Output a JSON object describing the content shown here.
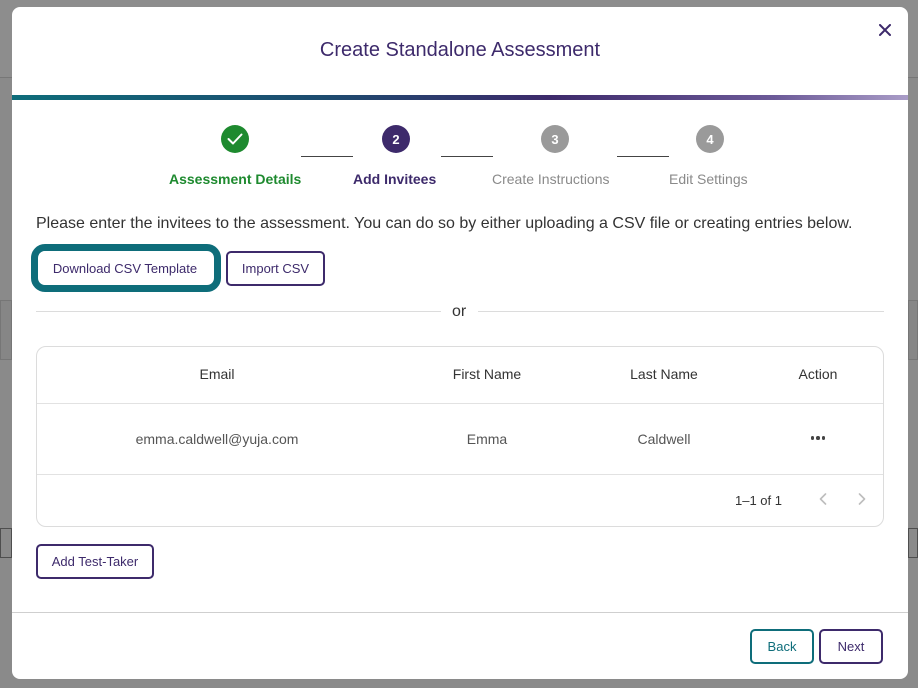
{
  "dialog": {
    "title": "Create Standalone Assessment",
    "close_icon": "close-icon"
  },
  "colors": {
    "accent": "#3d2a6b",
    "teal": "#0e6d7a",
    "success": "#1e8a2f",
    "pending": "#9a9a9a"
  },
  "stepper": {
    "steps": [
      {
        "number": "1",
        "label": "Assessment Details",
        "state": "done",
        "icon": "check-icon"
      },
      {
        "number": "2",
        "label": "Add Invitees",
        "state": "active"
      },
      {
        "number": "3",
        "label": "Create Instructions",
        "state": "pending"
      },
      {
        "number": "4",
        "label": "Edit Settings",
        "state": "pending"
      }
    ]
  },
  "instructions": "Please enter the invitees to the assessment. You can do so by either uploading a CSV file or creating entries below.",
  "buttons": {
    "download_csv": "Download CSV Template",
    "import_csv": "Import CSV",
    "add_test_taker": "Add Test-Taker",
    "back": "Back",
    "next": "Next"
  },
  "divider_text": "or",
  "table": {
    "columns": [
      "Email",
      "First Name",
      "Last Name",
      "Action"
    ],
    "rows": [
      {
        "email": "emma.caldwell@yuja.com",
        "first_name": "Emma",
        "last_name": "Caldwell",
        "action_icon": "more-horizontal-icon"
      }
    ],
    "pagination": {
      "range": "1–1 of 1",
      "prev_icon": "chevron-left-icon",
      "next_icon": "chevron-right-icon"
    }
  }
}
